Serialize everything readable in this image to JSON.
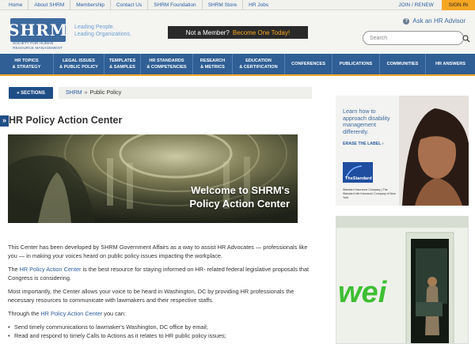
{
  "topnav": {
    "links": [
      "Home",
      "About SHRM",
      "Membership",
      "Contact Us",
      "SHRM Foundation",
      "SHRM Store",
      "HR Jobs"
    ],
    "join": "JOIN / RENEW",
    "signin": "SIGN IN"
  },
  "header": {
    "logo": "SHRM",
    "logo_subtitle": "SOCIETY FOR HUMAN RESOURCE MANAGEMENT",
    "tagline_line1": "Leading People.",
    "tagline_line2": "Leading Organizations.",
    "member_prompt": "Not a Member?",
    "member_cta": "Become One Today!",
    "advisor_label": "Ask an HR Advisor",
    "search_placeholder": "Search"
  },
  "mainnav": {
    "items": [
      {
        "line1": "HR TOPICS",
        "line2": "& STRATEGY"
      },
      {
        "line1": "LEGAL ISSUES",
        "line2": "& PUBLIC POLICY"
      },
      {
        "line1": "TEMPLATES",
        "line2": "& SAMPLES"
      },
      {
        "line1": "HR STANDARDS",
        "line2": "& COMPETENCIES"
      },
      {
        "line1": "RESEARCH",
        "line2": "& METRICS"
      },
      {
        "line1": "EDUCATION",
        "line2": "& CERTIFICATION"
      },
      {
        "line1": "CONFERENCES",
        "line2": ""
      },
      {
        "line1": "PUBLICATIONS",
        "line2": ""
      },
      {
        "line1": "COMMUNITIES",
        "line2": ""
      },
      {
        "line1": "HR ANSWERS",
        "line2": ""
      }
    ]
  },
  "sections_label": "« SECTIONS",
  "breadcrumb": {
    "link": "SHRM",
    "separator": "»",
    "current": "Public Policy"
  },
  "side_tab": "»",
  "page_title": "HR Policy Action Center",
  "hero": {
    "line1": "Welcome to SHRM's",
    "line2": "Policy Action Center"
  },
  "content": {
    "p1": "This Center has been developed by SHRM Government Affairs as a way to assist HR Advocates — professionals like you — in making your voices heard on public policy issues impacting the workplace.",
    "p2_prefix": "The ",
    "p2_link": "HR Policy Action Center",
    "p2_suffix": " is the best resource for staying informed on HR- related federal legislative proposals that Congress is considering.",
    "p3": "Most importantly, the Center allows your voice to be heard in Washington, DC by providing HR professionals the necessary resources to communicate with lawmakers and their respective staffs.",
    "p4_prefix": "Through the ",
    "p4_link": "HR Policy Action Center",
    "p4_suffix": " you can:",
    "bullets": [
      "Send timely communications to lawmaker's Washington, DC office by email;",
      "Read and respond to timely Calls to Actions as it relates to HR public policy issues;"
    ]
  },
  "ad1": {
    "headline": "Learn how to approach disability management differently.",
    "link": "ERASE THE LABEL ›",
    "logo": "TheStandard",
    "small_print": "Standard Insurance Company | The Standard Life Insurance Company of New York"
  },
  "ad2": {
    "brand_partial": "wei"
  },
  "colors": {
    "brand_blue": "#2f5f95",
    "accent_orange": "#f5a623",
    "link_blue": "#2a5d9f"
  }
}
